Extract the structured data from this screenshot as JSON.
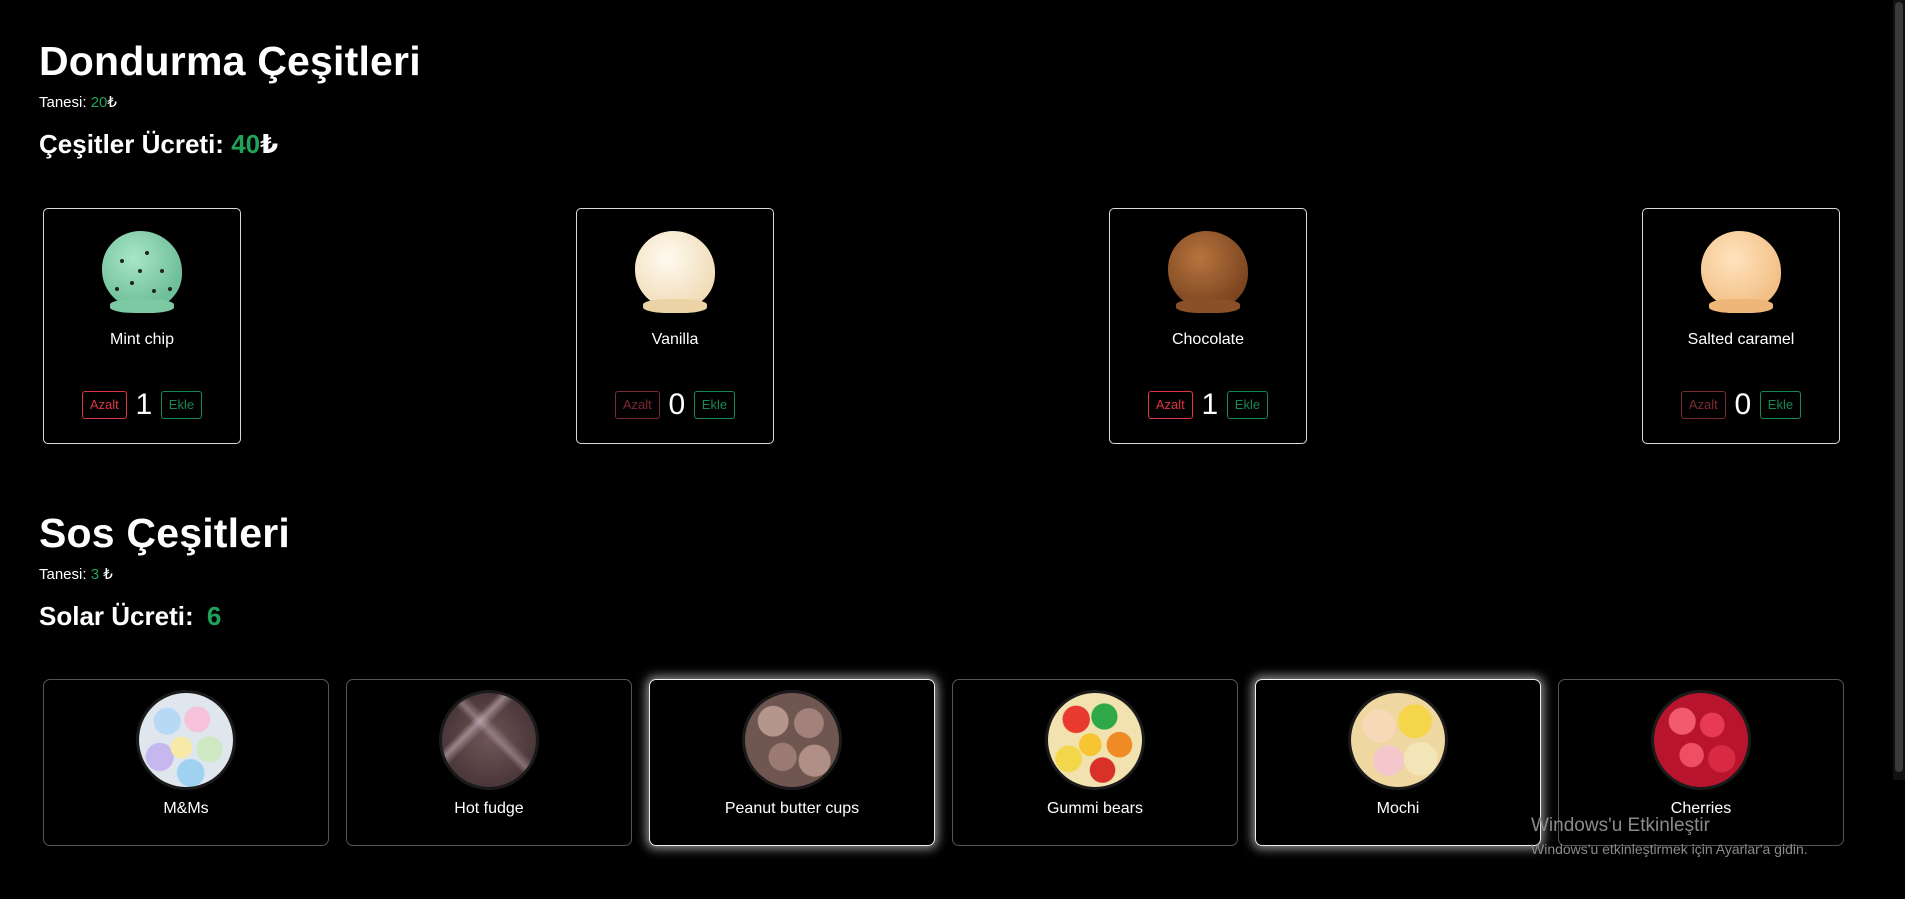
{
  "icecream": {
    "title": "Dondurma Çeşitleri",
    "unit_label": "Tanesi:",
    "unit_price": "20",
    "currency": "₺",
    "total_label": "Çeşitler Ücreti:",
    "total_value": "40",
    "dec_label": "Azalt",
    "inc_label": "Ekle",
    "items": [
      {
        "name": "Mint chip",
        "qty": "1",
        "dec_enabled": true
      },
      {
        "name": "Vanilla",
        "qty": "0",
        "dec_enabled": false
      },
      {
        "name": "Chocolate",
        "qty": "1",
        "dec_enabled": true
      },
      {
        "name": "Salted caramel",
        "qty": "0",
        "dec_enabled": false
      }
    ]
  },
  "sauce": {
    "title": "Sos Çeşitleri",
    "unit_label": "Tanesi:",
    "unit_price": "3",
    "currency": "₺",
    "total_label": "Solar Ücreti:",
    "total_value": "6",
    "items": [
      {
        "name": "M&Ms",
        "selected": false
      },
      {
        "name": "Hot fudge",
        "selected": false
      },
      {
        "name": "Peanut butter cups",
        "selected": true
      },
      {
        "name": "Gummi bears",
        "selected": false
      },
      {
        "name": "Mochi",
        "selected": true
      },
      {
        "name": "Cherries",
        "selected": false
      }
    ]
  },
  "watermark": {
    "title": "Windows'u Etkinleştir",
    "subtitle": "Windows'u etkinleştirmek için Ayarlar'a gidin."
  },
  "colors": {
    "accent_green": "#1fa35a",
    "danger": "#dc3545",
    "success": "#198754"
  }
}
